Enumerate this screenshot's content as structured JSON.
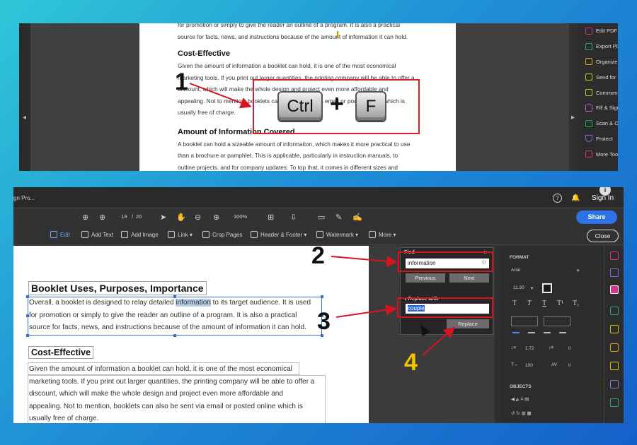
{
  "step_labels": {
    "one": "1",
    "two": "2",
    "three": "3",
    "four": "4"
  },
  "keys": {
    "ctrl": "Ctrl",
    "plus": "+",
    "f": "F"
  },
  "top_doc": {
    "line1": "for promotion or simply to give the reader an outline of a program. It is also a practical",
    "line2": "source for facts, news, and instructions because of the amount of information it can hold.",
    "heading1": "Cost-Effective",
    "para1": [
      "Given the amount of information a booklet can hold, it is one of the most economical",
      "marketing tools. If you print out larger quantities, the printing company will be able to offer a",
      "discount, which will make the whole design and project even more affordable and",
      "appealing. Not to mention, booklets can also be sent via email or posted online which is",
      "usually free of charge."
    ],
    "heading2": "Amount of Information Covered",
    "para2": [
      "A booklet can hold a sizeable amount of information, which makes it more practical to use",
      "than a brochure or pamphlet. This is applicable, particularly in instruction manuals, to",
      "outline projects, and for company updates. To top that, it comes in different sizes and"
    ]
  },
  "top_tools": [
    {
      "label": "Edit PDF",
      "color": "#d6338a"
    },
    {
      "label": "Export PDF",
      "color": "#2aa37a"
    },
    {
      "label": "Organize",
      "color": "#e0a21c"
    },
    {
      "label": "Send for",
      "color": "#d9c01b"
    },
    {
      "label": "Comment",
      "color": "#d9c01b"
    },
    {
      "label": "Fill & Sign",
      "color": "#a467d6"
    },
    {
      "label": "Scan & OCR",
      "color": "#2aa37a"
    },
    {
      "label": "Protect",
      "color": "#7d6ae0"
    },
    {
      "label": "More Tools",
      "color": "#d6338a"
    }
  ],
  "app": {
    "title_fragment": "gn Pro...",
    "help": "?",
    "bell": "🔔",
    "avatar": "i",
    "signin": "Sign In",
    "page_current": "13",
    "page_sep": "/",
    "page_total": "20",
    "zoom": "100%",
    "share": "Share",
    "close": "Close"
  },
  "edit_toolbar": [
    "Edit",
    "Add Text",
    "Add Image",
    "Link ▾",
    "Crop Pages",
    "Header & Footer ▾",
    "Watermark ▾",
    "More ▾"
  ],
  "bottom_doc": {
    "heading1": "Booklet Uses, Purposes, Importance",
    "p1_line1_a": "Overall, a booklet is designed to relay detailed ",
    "p1_line1_hl": "information",
    "p1_line1_b": " to its target audience. It is used",
    "p1_line2": "for promotion or simply to give the reader an outline of a program. It is also a practical",
    "p1_line3": "source for facts, news, and instructions because of the amount of information it can hold.",
    "heading2": "Cost-Effective",
    "para2": [
      "Given the amount of information a booklet can hold, it is one of the most economical",
      "marketing tools. If you print out larger quantities, the printing company will be able to offer a",
      "discount, which will make the whole design and project even more affordable and",
      "appealing. Not to mention, booklets can also be sent via email or posted online which is",
      "usually free of charge."
    ]
  },
  "find": {
    "title": "Find",
    "close": "×",
    "search_value": "information",
    "previous": "Previous",
    "next": "Next",
    "replace_label": "▾ Replace with",
    "replace_value": "couple",
    "replace_button": "Replace"
  },
  "format": {
    "section": "FORMAT",
    "font": "Arial",
    "size": "11.50",
    "line_spacing": "1.72",
    "para_spacing": "0",
    "scale": "100",
    "char_spacing": "0",
    "objects": "OBJECTS"
  },
  "right_tools": [
    "#d6338a",
    "#7d6ae0",
    "#d6338a",
    "#2aa37a",
    "#d9c01b",
    "#e0a21c",
    "#d9c01b",
    "#a467d6",
    "#2aa37a"
  ]
}
